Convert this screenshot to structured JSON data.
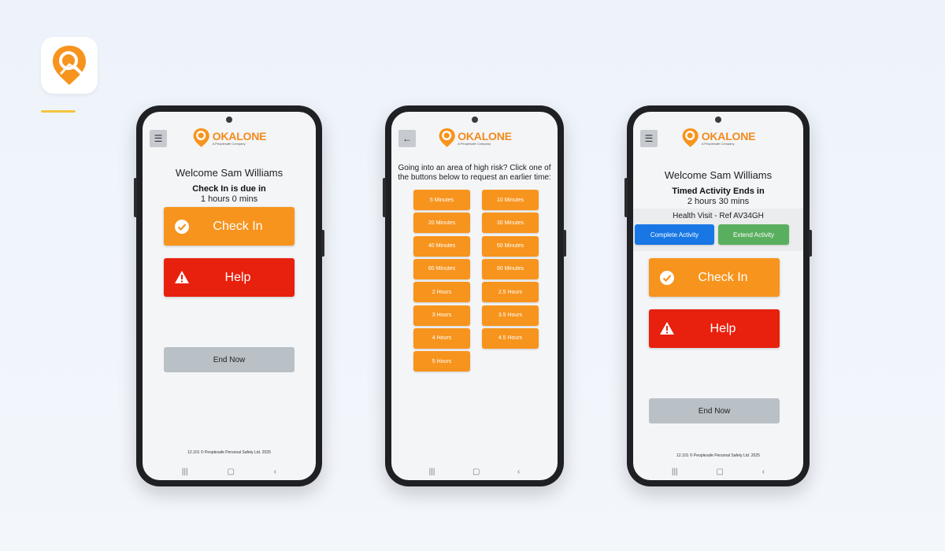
{
  "brand": {
    "name_ok": "OK",
    "name_alone": "ALONE",
    "tagline": "A Peoplesafe Company",
    "accent": "#f7941d"
  },
  "phone1": {
    "welcome": "Welcome Sam Williams",
    "status_title": "Check In is due in",
    "status_value": "1 hours 0 mins",
    "checkin_label": "Check In",
    "help_label": "Help",
    "end_label": "End Now",
    "footer": "12.101 © Peoplesafe Personal Safety Ltd. 2025"
  },
  "phone2": {
    "prompt": "Going into an area of high risk? Click one of the buttons below to request an earlier time:",
    "left_options": [
      "5 Minutes",
      "20 Minutes",
      "40 Minutes",
      "60 Minutes",
      "2 Hours",
      "3 Hours",
      "4 Hours",
      "5 Hours"
    ],
    "right_options": [
      "10 Minutes",
      "30 Minutes",
      "50 Minutes",
      "90 Minutes",
      "2.5 Hours",
      "3.5 Hours",
      "4.5 Hours"
    ]
  },
  "phone3": {
    "welcome": "Welcome Sam Williams",
    "status_title": "Timed Activity Ends in",
    "status_value": "2 hours 30 mins",
    "visit_label": "Health Visit - Ref AV34GH",
    "complete_label": "Complete Activity",
    "extend_label": "Extend Activity",
    "checkin_label": "Check In",
    "help_label": "Help",
    "end_label": "End Now",
    "footer": "12.101 © Peoplesafe Personal Safety Ltd. 2025"
  },
  "icons": {
    "menu": "hamburger-menu-icon",
    "back": "arrow-left-icon",
    "check": "check-circle-icon",
    "warning": "warning-triangle-icon"
  }
}
